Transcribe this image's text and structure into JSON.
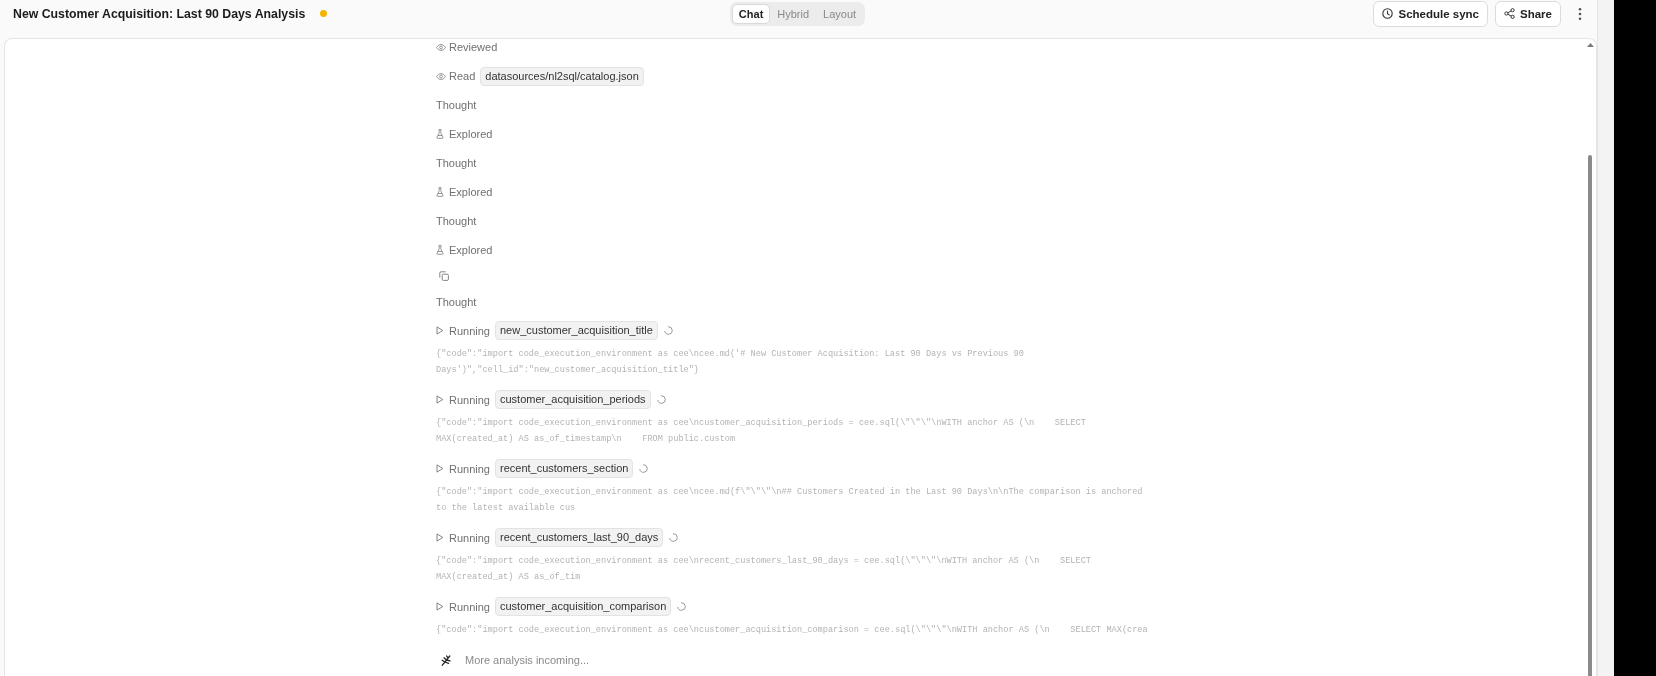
{
  "header": {
    "title": "New Customer Acquisition: Last 90 Days Analysis",
    "status_dot": {
      "color": "#f5b400"
    },
    "view_tabs": [
      {
        "label": "Chat",
        "selected": true
      },
      {
        "label": "Hybrid",
        "selected": false
      },
      {
        "label": "Layout",
        "selected": false
      }
    ],
    "actions": [
      {
        "kind": "clock",
        "label": "Schedule sync"
      },
      {
        "kind": "share",
        "label": "Share"
      }
    ]
  },
  "activity": [
    {
      "kind": "viewed",
      "label": "Reviewed"
    },
    {
      "kind": "viewed",
      "label": "Read",
      "chip": "datasources/nl2sql/catalog.json"
    },
    {
      "kind": "thought",
      "label": "Thought"
    },
    {
      "kind": "explored",
      "label": "Explored"
    },
    {
      "kind": "thought",
      "label": "Thought"
    },
    {
      "kind": "explored",
      "label": "Explored"
    },
    {
      "kind": "thought",
      "label": "Thought"
    },
    {
      "kind": "explored",
      "label": "Explored"
    },
    {
      "kind": "copy"
    },
    {
      "kind": "thought",
      "label": "Thought"
    },
    {
      "kind": "running",
      "label": "Running",
      "chip": "new_customer_acquisition_title",
      "code": "{\"code\":\"import code_execution_environment as cee\\ncee.md('# New Customer Acquisition: Last 90 Days vs Previous 90 Days')\",\"cell_id\":\"new_customer_acquisition_title\"}"
    },
    {
      "kind": "running",
      "label": "Running",
      "chip": "customer_acquisition_periods",
      "code": "{\"code\":\"import code_execution_environment as cee\\ncustomer_acquisition_periods = cee.sql(\\\"\\\"\\\"\\nWITH anchor AS (\\n    SELECT MAX(created_at) AS as_of_timestamp\\n    FROM public.custom"
    },
    {
      "kind": "running",
      "label": "Running",
      "chip": "recent_customers_section",
      "code": "{\"code\":\"import code_execution_environment as cee\\ncee.md(f\\\"\\\"\\\"\\n## Customers Created in the Last 90 Days\\n\\nThe comparison is anchored to the latest available cus"
    },
    {
      "kind": "running",
      "label": "Running",
      "chip": "recent_customers_last_90_days",
      "code": "{\"code\":\"import code_execution_environment as cee\\nrecent_customers_last_90_days = cee.sql(\\\"\\\"\\\"\\nWITH anchor AS (\\n    SELECT MAX(created_at) AS as_of_tim"
    },
    {
      "kind": "running",
      "label": "Running",
      "chip": "customer_acquisition_comparison",
      "code": "{\"code\":\"import code_execution_environment as cee\\ncustomer_acquisition_comparison = cee.sql(\\\"\\\"\\\"\\nWITH anchor AS (\\n    SELECT MAX(crea"
    }
  ],
  "footer": {
    "text": "More analysis incoming..."
  }
}
